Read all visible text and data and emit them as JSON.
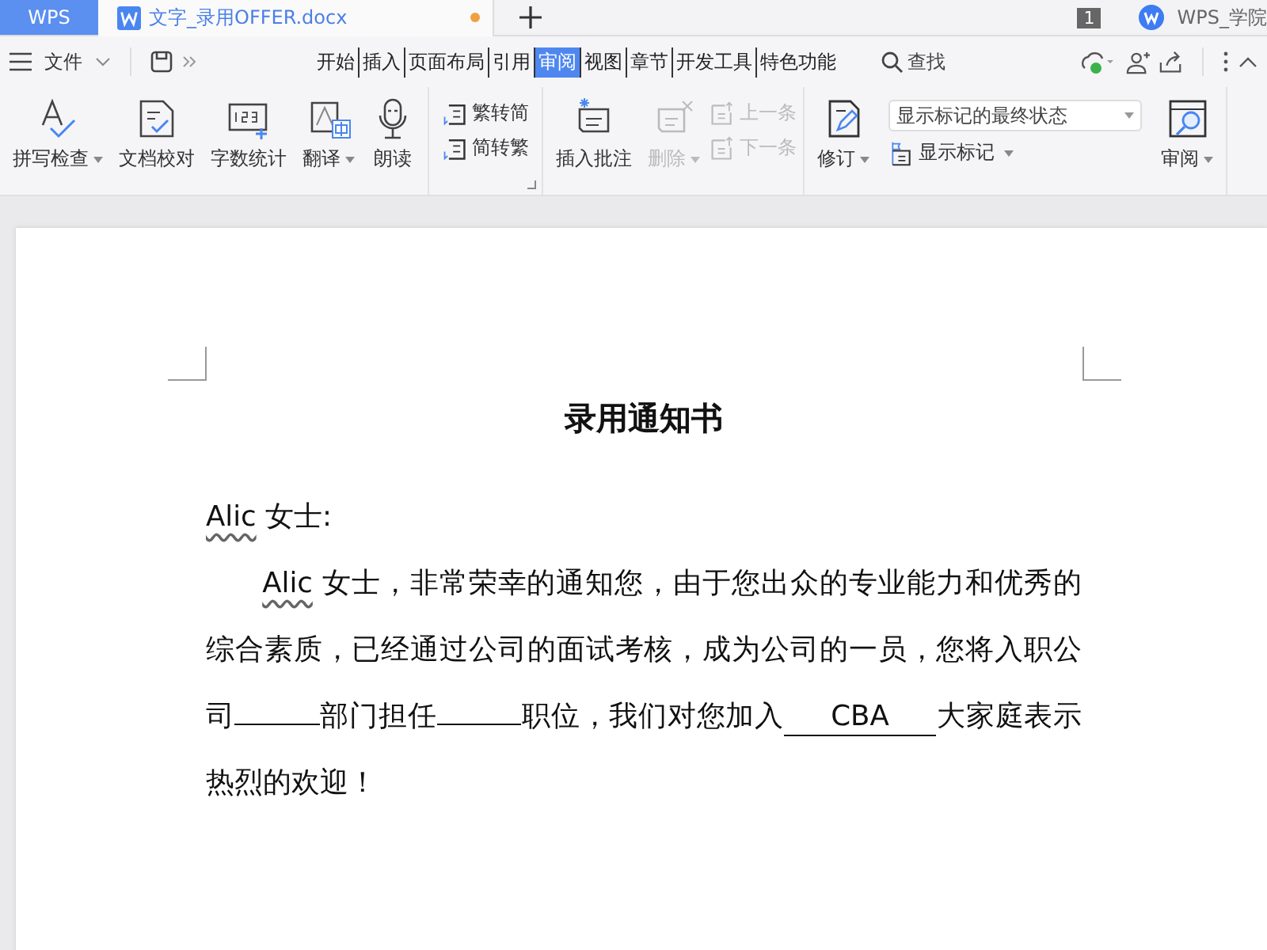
{
  "title_bar": {
    "app_tab": "WPS",
    "doc_tab": {
      "label": "文字_录用OFFER.docx",
      "modified": true
    },
    "window_count": "1",
    "account": "WPS_学院"
  },
  "menu": {
    "file_label": "文件",
    "tabs": [
      {
        "label": "开始",
        "selected": false
      },
      {
        "label": "插入",
        "selected": false
      },
      {
        "label": "页面布局",
        "selected": false
      },
      {
        "label": "引用",
        "selected": false
      },
      {
        "label": "审阅",
        "selected": true
      },
      {
        "label": "视图",
        "selected": false
      },
      {
        "label": "章节",
        "selected": false
      },
      {
        "label": "开发工具",
        "selected": false
      },
      {
        "label": "特色功能",
        "selected": false
      }
    ],
    "search_label": "查找"
  },
  "ribbon": {
    "proofing": [
      {
        "label": "拼写检查",
        "dropdown": true,
        "disabled": false
      },
      {
        "label": "文档校对",
        "dropdown": false,
        "disabled": false
      },
      {
        "label": "字数统计",
        "dropdown": false,
        "disabled": false
      },
      {
        "label": "翻译",
        "dropdown": true,
        "disabled": false
      },
      {
        "label": "朗读",
        "dropdown": false,
        "disabled": false
      }
    ],
    "convert": [
      {
        "label": "繁转简",
        "disabled": false
      },
      {
        "label": "简转繁",
        "disabled": false
      }
    ],
    "comments": {
      "insert": {
        "label": "插入批注",
        "dropdown": false,
        "disabled": false
      },
      "delete": {
        "label": "删除",
        "dropdown": true,
        "disabled": true
      },
      "nav": [
        {
          "label": "上一条",
          "disabled": true
        },
        {
          "label": "下一条",
          "disabled": true
        }
      ]
    },
    "tracking": {
      "revise": {
        "label": "修订",
        "dropdown": true,
        "disabled": false
      },
      "display_select": {
        "value": "显示标记的最终状态"
      },
      "show_markup": {
        "label": "显示标记",
        "dropdown": true,
        "disabled": false
      },
      "review": {
        "label": "审阅",
        "dropdown": true,
        "disabled": false
      }
    }
  },
  "document": {
    "title": "录用通知书",
    "salutation": [
      {
        "kind": "flagged",
        "text": "Alic"
      },
      {
        "kind": "text",
        "text": " 女士:"
      }
    ],
    "body": [
      {
        "kind": "flagged",
        "text": "Alic"
      },
      {
        "kind": "text",
        "text": " 女士，非常荣幸的通知您，由于您出众的专业能力和优秀的综合素质，已经通过公司的面试考核，成为公司的一员，您将入职公司"
      },
      {
        "kind": "blank"
      },
      {
        "kind": "text",
        "text": "部门担任"
      },
      {
        "kind": "blank"
      },
      {
        "kind": "text",
        "text": "职位，我们对您加入"
      },
      {
        "kind": "blank",
        "text": "CBA"
      },
      {
        "kind": "text",
        "text": "大家庭表示热烈的欢迎！"
      }
    ]
  }
}
